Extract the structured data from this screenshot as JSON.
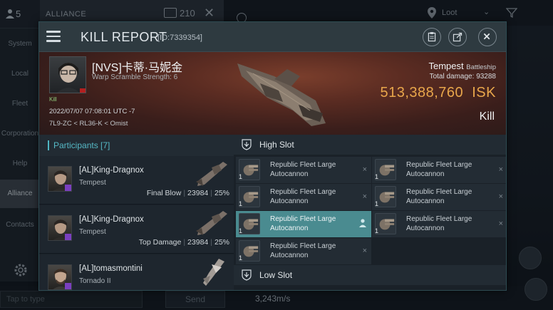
{
  "background": {
    "user_count": "5",
    "alliance_title": "ALLIANCE",
    "chat_count": "210",
    "sidebar": [
      "System",
      "Local",
      "Fleet",
      "Corporation",
      "Help",
      "Alliance",
      "Contacts"
    ],
    "loot_label": "Loot",
    "chat_placeholder": "Tap to type",
    "send_label": "Send",
    "speed": "3,243m/s"
  },
  "kill_report": {
    "title": "KILL REPORT",
    "id": "[ID:7339354]",
    "victim": {
      "name": "[NVS]卡蒂·马妮金",
      "subtitle": "Warp Scramble Strength: 6",
      "tag": "Kill",
      "date": "2022/07/07 07:08:01 UTC -7",
      "location": "7L9-ZC < RL36-K < Omist"
    },
    "ship": {
      "name": "Tempest",
      "class": "Battleship",
      "total_damage_label": "Total damage:",
      "total_damage": "93288",
      "isk_value": "513,388,760",
      "isk_unit": "ISK",
      "result": "Kill"
    },
    "participants": {
      "title": "Participants",
      "count": "[7]",
      "items": [
        {
          "name": "[AL]King-Dragnox",
          "ship": "Tempest",
          "role": "Final Blow",
          "damage": "23984",
          "percent": "25%"
        },
        {
          "name": "[AL]King-Dragnox",
          "ship": "Tempest",
          "role": "Top Damage",
          "damage": "23984",
          "percent": "25%"
        },
        {
          "name": "[AL]tomasmontini",
          "ship": "Tornado II",
          "role": "",
          "damage": "",
          "percent": ""
        }
      ]
    },
    "high_slot": {
      "label": "High Slot",
      "modules": [
        {
          "name": "Republic Fleet Large Autocannon",
          "qty": "1",
          "status": "×"
        },
        {
          "name": "Republic Fleet Large Autocannon",
          "qty": "1",
          "status": "×"
        },
        {
          "name": "Republic Fleet Large Autocannon",
          "qty": "1",
          "status": "×"
        },
        {
          "name": "Republic Fleet Large Autocannon",
          "qty": "1",
          "status": "×"
        },
        {
          "name": "Republic Fleet Large Autocannon",
          "qty": "1",
          "status": "dropped"
        },
        {
          "name": "Republic Fleet Large Autocannon",
          "qty": "1",
          "status": "×"
        },
        {
          "name": "Republic Fleet Large Autocannon",
          "qty": "1",
          "status": "×"
        }
      ]
    },
    "low_slot": {
      "label": "Low Slot"
    }
  }
}
